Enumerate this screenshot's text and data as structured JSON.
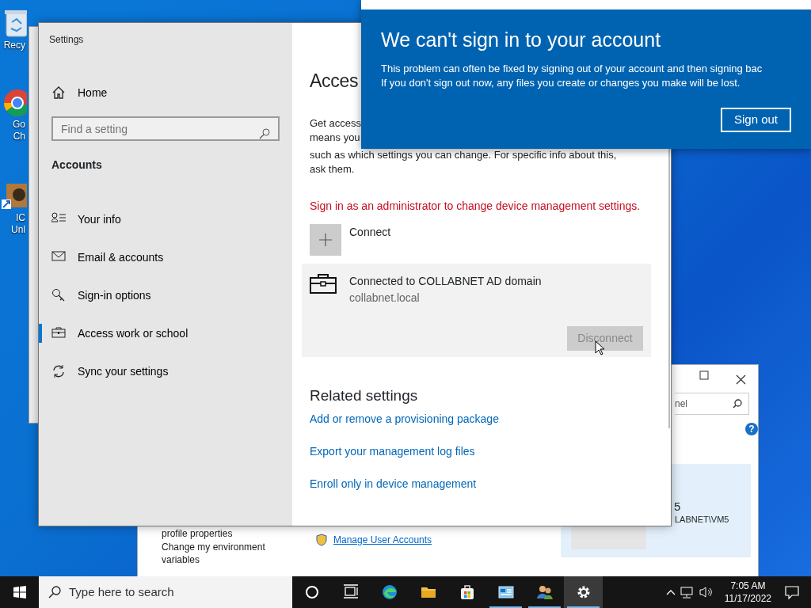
{
  "desktop_icons": [
    {
      "kind": "recycle",
      "lines": [
        "Recy"
      ]
    },
    {
      "kind": "chrome",
      "lines": [
        "Go",
        "Ch"
      ]
    },
    {
      "kind": "app",
      "lines": [
        "IC",
        "Unl"
      ]
    }
  ],
  "background_window": {
    "search_value": "nel",
    "help_glyph": "?",
    "user_name": "5",
    "user_account": "LABNET\\VM5",
    "left_links": [
      "profile properties",
      "Change my environment variables"
    ],
    "link": "Manage User Accounts"
  },
  "settings": {
    "title": "Settings",
    "home": "Home",
    "search": {
      "placeholder": "Find a setting"
    },
    "section": "Accounts",
    "nav": [
      {
        "kind": "person",
        "label": "Your info",
        "selected": false
      },
      {
        "kind": "mail",
        "label": "Email & accounts",
        "selected": false
      },
      {
        "kind": "key",
        "label": "Sign-in options",
        "selected": false
      },
      {
        "kind": "briefcase",
        "label": "Access work or school",
        "selected": true
      },
      {
        "kind": "sync",
        "label": "Sync your settings",
        "selected": false
      }
    ],
    "heading": "Acces",
    "intro_lines": [
      "Get access",
      "means you",
      "such as which settings you can change. For specific info about this,",
      "ask them."
    ],
    "warning": "Sign in as an administrator to change device management settings.",
    "connect": "Connect",
    "account": {
      "title": "Connected to COLLABNET AD domain",
      "subtitle": "collabnet.local",
      "button": "Disconnect",
      "disabled": true
    },
    "related_heading": "Related settings",
    "related_links": [
      "Add or remove a provisioning package",
      "Export your management log files",
      "Enroll only in device management"
    ]
  },
  "toast": {
    "title": "We can't sign in to your account",
    "lines": [
      "This problem can often be fixed by signing out of your account and then signing bac",
      "If you don't sign out now, any files you create or changes you make will be lost."
    ],
    "button": "Sign out"
  },
  "taskbar": {
    "search_placeholder": "Type here to search",
    "apps": [
      {
        "kind": "circle",
        "running": false,
        "active": false
      },
      {
        "kind": "taskview",
        "running": false,
        "active": false
      },
      {
        "kind": "edge",
        "running": false,
        "active": false
      },
      {
        "kind": "folder",
        "running": false,
        "active": false
      },
      {
        "kind": "store",
        "running": false,
        "active": false
      },
      {
        "kind": "panel",
        "running": true,
        "active": false
      },
      {
        "kind": "users",
        "running": true,
        "active": false
      },
      {
        "kind": "gear",
        "running": true,
        "active": true
      }
    ],
    "time": "7:05 AM",
    "date": "11/17/2022"
  }
}
